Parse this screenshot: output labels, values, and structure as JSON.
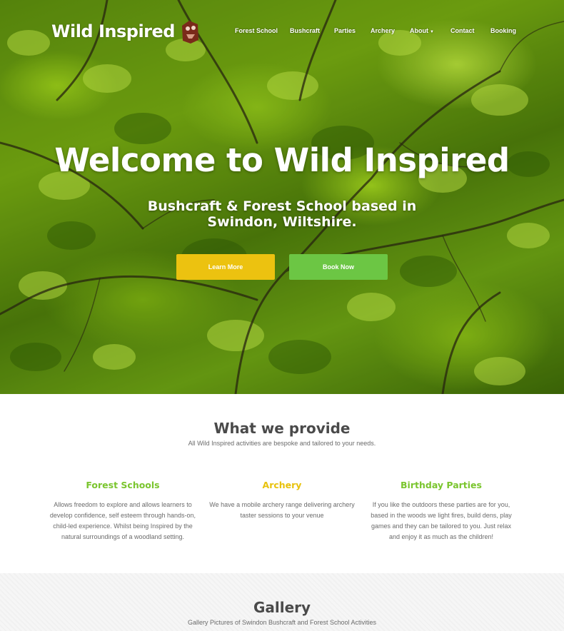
{
  "brand": {
    "name": "Wild Inspired"
  },
  "nav": {
    "items": [
      {
        "label": "Forest School"
      },
      {
        "label": "Bushcraft"
      },
      {
        "label": "Parties"
      },
      {
        "label": "Archery"
      },
      {
        "label": "About",
        "has_dropdown": true
      },
      {
        "label": "Contact"
      },
      {
        "label": "Booking"
      }
    ]
  },
  "hero": {
    "title": "Welcome to Wild Inspired",
    "subtitle": "Bushcraft & Forest School based in Swindon, Wiltshire.",
    "learn_more_label": "Learn More",
    "book_now_label": "Book Now"
  },
  "provide": {
    "title": "What we provide",
    "subtitle": "All Wild Inspired activities are bespoke and tailored to your needs.",
    "cards": [
      {
        "title": "Forest Schools",
        "text": "Allows freedom to explore and allows learners to develop confidence, self esteem through hands-on, child-led experience. Whilst being Inspired by the natural surroundings of a woodland setting.",
        "color": "#7ac52e"
      },
      {
        "title": "Archery",
        "text": "We have a mobile archery range delivering archery taster sessions to your venue",
        "color": "#e8c20c"
      },
      {
        "title": "Birthday Parties",
        "text": "If you like the outdoors these parties are for you, based in the woods we light fires, build dens, play games and they can be tailored to you. Just relax and enjoy it as much as the children!",
        "color": "#7ac52e"
      }
    ]
  },
  "gallery": {
    "title": "Gallery",
    "subtitle": "Gallery Pictures of Swindon Bushcraft and Forest School Activities"
  },
  "colors": {
    "learn_more": "#ecc210",
    "book_now": "#6cc644",
    "heading": "#4a4a4a"
  }
}
